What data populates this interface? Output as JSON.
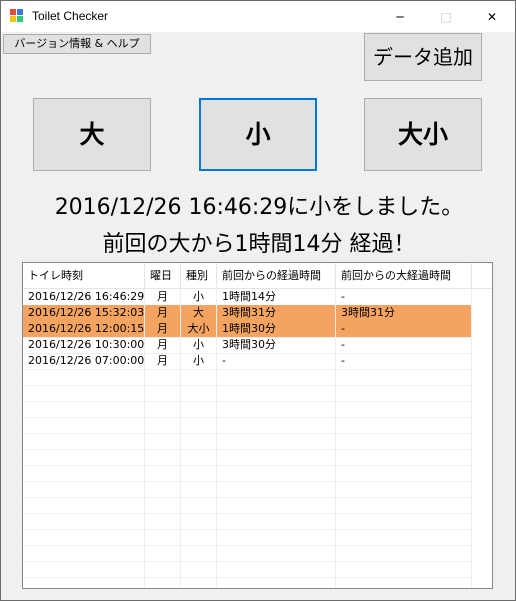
{
  "window": {
    "title": "Toilet Checker",
    "controls": {
      "minimize": "─",
      "maximize": "□",
      "close": "✕"
    }
  },
  "toolbar": {
    "help_label": "バージョン情報 & ヘルプ",
    "add_data_label": "データ追加"
  },
  "buttons": {
    "big_label": "大",
    "small_label": "小",
    "both_label": "大小"
  },
  "message": {
    "line1": "2016/12/26 16:46:29に小をしました。",
    "line2": "前回の大から1時間14分 経過！"
  },
  "table": {
    "headers": [
      "トイレ時刻",
      "曜日",
      "種別",
      "前回からの経過時間",
      "前回からの大経過時間"
    ],
    "rows": [
      {
        "time": "2016/12/26 16:46:29",
        "day": "月",
        "type": "小",
        "since_last": "1時間14分",
        "since_big": "-",
        "highlight": false
      },
      {
        "time": "2016/12/26 15:32:03",
        "day": "月",
        "type": "大",
        "since_last": "3時間31分",
        "since_big": "3時間31分",
        "highlight": true
      },
      {
        "time": "2016/12/26 12:00:15",
        "day": "月",
        "type": "大小",
        "since_last": "1時間30分",
        "since_big": "-",
        "highlight": true
      },
      {
        "time": "2016/12/26 10:30:00",
        "day": "月",
        "type": "小",
        "since_last": "3時間30分",
        "since_big": "-",
        "highlight": false
      },
      {
        "time": "2016/12/26 07:00:00",
        "day": "月",
        "type": "小",
        "since_last": "-",
        "since_big": "-",
        "highlight": false
      }
    ],
    "highlight_color": "#f4a460"
  },
  "colors": {
    "focus_border": "#0078d7",
    "button_face": "#e1e1e1"
  }
}
